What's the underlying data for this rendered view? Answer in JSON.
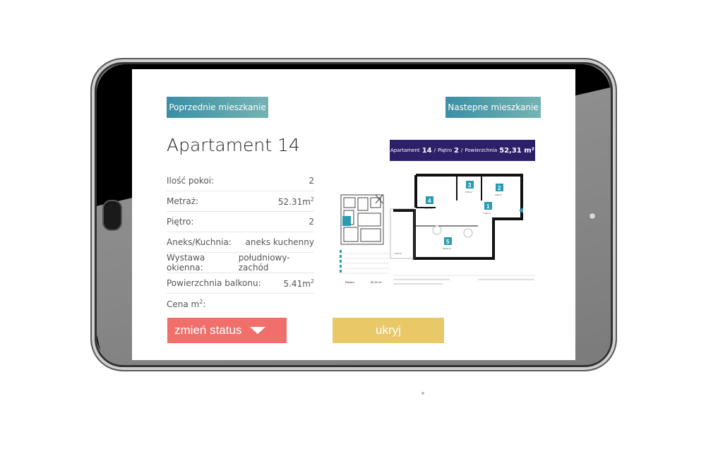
{
  "nav": {
    "prev_label": "Poprzednie mieszkanie",
    "next_label": "Nastepne mieszkanie"
  },
  "apartment": {
    "title": "Apartament 14",
    "properties": [
      {
        "label": "Ilość pokoi:",
        "value": "2"
      },
      {
        "label": "Metraż:",
        "value": "52.31m",
        "sup": "2"
      },
      {
        "label": "Piętro:",
        "value": "2"
      },
      {
        "label": "Aneks/Kuchnia:",
        "value": "aneks kuchenny"
      },
      {
        "label": "Wystawa okienna:",
        "value": "południowy-zachód"
      },
      {
        "label": "Powierzchnia balkonu:",
        "value": "5.41m",
        "sup": "2"
      },
      {
        "label": "Cena m",
        "label_sup": "2",
        "label_suffix": ":",
        "value": ""
      }
    ]
  },
  "actions": {
    "status_label": "zmień status",
    "hide_label": "ukryj"
  },
  "plan": {
    "header_apartment_word": "Apartament",
    "header_apartment_num": "14",
    "header_floor_word": "Piętro",
    "header_floor_num": "2",
    "header_area_word": "Powierzchnia",
    "header_area_val": "52,31 m²",
    "rooms": [
      {
        "num": "1",
        "area": "6,15 m²"
      },
      {
        "num": "2",
        "area": "4,95 m²"
      },
      {
        "num": "3",
        "area": "3,76 m²"
      },
      {
        "num": "4",
        "area": "11,37 m²"
      },
      {
        "num": "5",
        "area": "20,04 m²"
      }
    ],
    "balcony_area": "5,41 m²",
    "total_label": "Razem",
    "total_value": "52,31 m²",
    "accent_color": "#2a9bb0"
  },
  "colors": {
    "status_button": "#f06f6b",
    "hide_button": "#e8c867",
    "plan_header": "#2e2068"
  }
}
